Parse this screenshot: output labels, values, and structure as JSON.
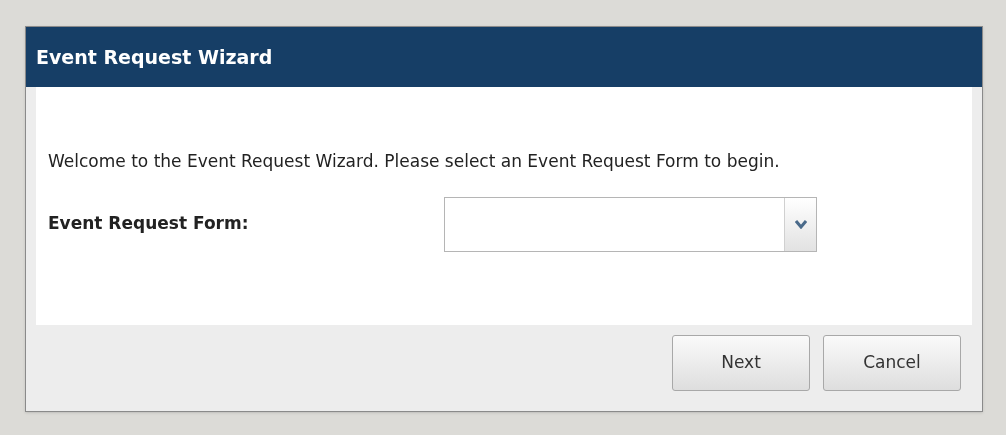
{
  "window": {
    "title": "Event Request Wizard"
  },
  "intro": "Welcome to the Event Request Wizard. Please select an Event Request Form to begin.",
  "form_field": {
    "label": "Event Request Form:"
  },
  "buttons": [
    "Next",
    "Cancel"
  ]
}
